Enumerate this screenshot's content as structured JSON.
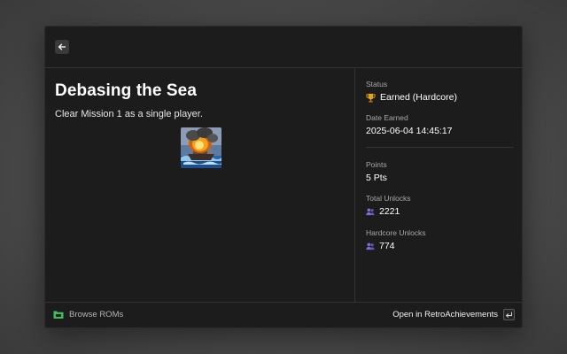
{
  "header": {
    "back_icon": "arrow-left-icon"
  },
  "achievement": {
    "title": "Debasing the Sea",
    "description": "Clear Mission 1 as a single player.",
    "badge_icon": "burning-ship-badge"
  },
  "details": {
    "status_label": "Status",
    "status_value": "Earned (Hardcore)",
    "status_icon": "trophy-icon",
    "date_label": "Date Earned",
    "date_value": "2025-06-04 14:45:17",
    "points_label": "Points",
    "points_value": "5 Pts",
    "total_unlocks_label": "Total Unlocks",
    "total_unlocks_value": "2221",
    "hardcore_unlocks_label": "Hardcore Unlocks",
    "hardcore_unlocks_value": "774",
    "users_icon": "users-icon"
  },
  "footer": {
    "browse_label": "Browse ROMs",
    "browse_icon": "rom-folder-icon",
    "open_label": "Open in RetroAchievements",
    "enter_icon": "enter-key-icon"
  },
  "colors": {
    "panel": "#1c1c1c",
    "divider": "#333333",
    "trophy": "#e0a020",
    "users": "#7b6fd6",
    "rom_icon": "#3fbf5a"
  }
}
